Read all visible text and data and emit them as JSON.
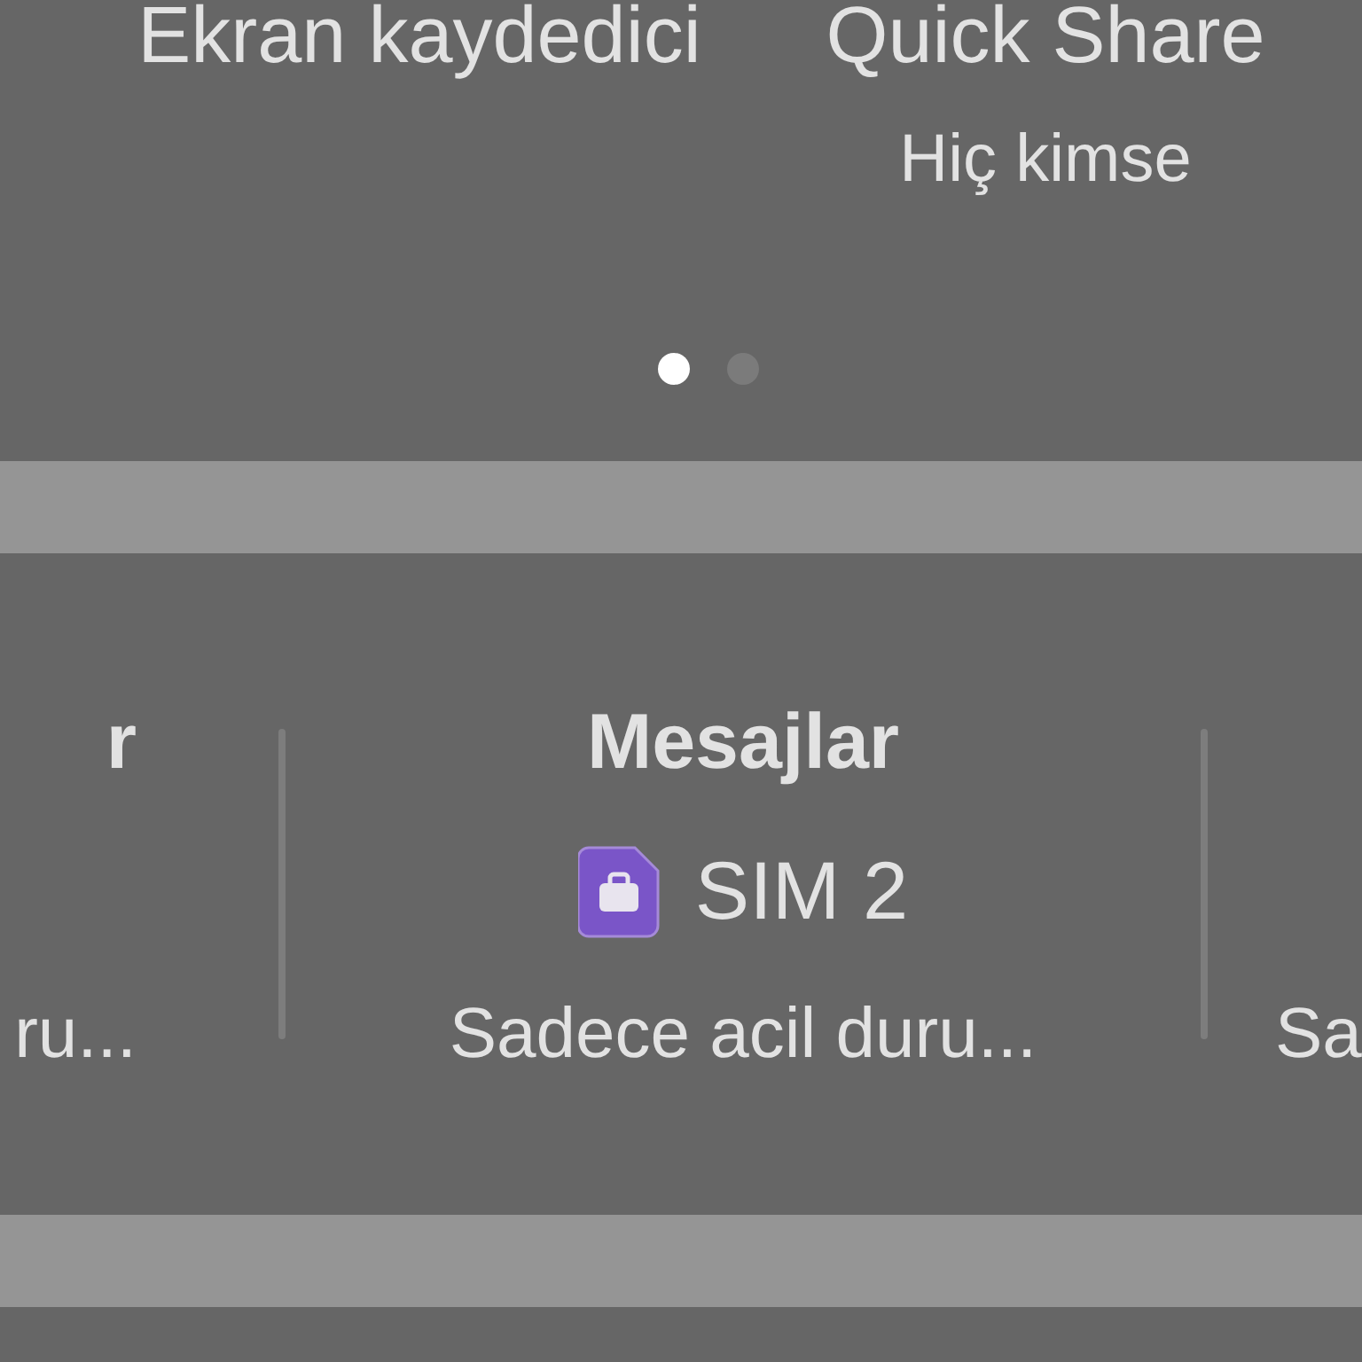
{
  "tiles": [
    {
      "label": "Ekran kaydedici"
    },
    {
      "label": "Quick Share",
      "status": "Hiç kimse"
    }
  ],
  "page_dots": [
    {
      "selected": true
    },
    {
      "selected": false
    }
  ],
  "sim_settings": [
    {
      "kind": "partial-left",
      "title": "r",
      "value": "ru..."
    },
    {
      "kind": "full",
      "title": "Mesajlar",
      "sim_label": "SIM 2",
      "value": "Sadece acil duru..."
    },
    {
      "kind": "partial-right",
      "value": "Sa"
    }
  ]
}
